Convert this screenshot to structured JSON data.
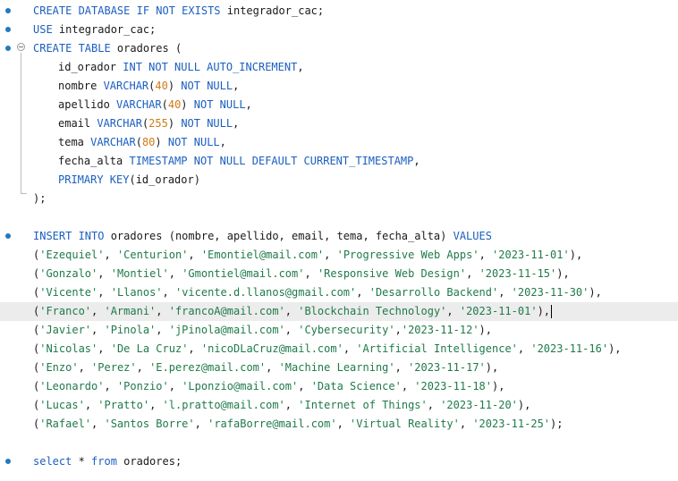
{
  "editor": {
    "colors": {
      "keyword": "#1b5fbf",
      "number": "#d27a16",
      "string": "#1f7a4a",
      "text": "#1a1a1a",
      "gutter_marker": "#1f7bc0",
      "current_line": "#ececec"
    },
    "lines": [
      {
        "marker": true,
        "tokens": [
          [
            "kw",
            "CREATE DATABASE IF NOT EXISTS "
          ],
          [
            "p",
            "integrador_cac;"
          ]
        ]
      },
      {
        "marker": true,
        "tokens": [
          [
            "kw",
            "USE "
          ],
          [
            "p",
            "integrador_cac;"
          ]
        ]
      },
      {
        "marker": true,
        "fold": true,
        "tokens": [
          [
            "kw",
            "CREATE TABLE "
          ],
          [
            "p",
            "oradores ("
          ]
        ]
      },
      {
        "indent": true,
        "tokens": [
          [
            "p",
            "id_orador "
          ],
          [
            "kw",
            "INT NOT NULL AUTO_INCREMENT"
          ],
          [
            "p",
            ","
          ]
        ]
      },
      {
        "indent": true,
        "tokens": [
          [
            "p",
            "nombre "
          ],
          [
            "kw",
            "VARCHAR"
          ],
          [
            "p",
            "("
          ],
          [
            "num",
            "40"
          ],
          [
            "p",
            ") "
          ],
          [
            "kw",
            "NOT NULL"
          ],
          [
            "p",
            ","
          ]
        ]
      },
      {
        "indent": true,
        "tokens": [
          [
            "p",
            "apellido "
          ],
          [
            "kw",
            "VARCHAR"
          ],
          [
            "p",
            "("
          ],
          [
            "num",
            "40"
          ],
          [
            "p",
            ") "
          ],
          [
            "kw",
            "NOT NULL"
          ],
          [
            "p",
            ","
          ]
        ]
      },
      {
        "indent": true,
        "tokens": [
          [
            "p",
            "email "
          ],
          [
            "kw",
            "VARCHAR"
          ],
          [
            "p",
            "("
          ],
          [
            "num",
            "255"
          ],
          [
            "p",
            ") "
          ],
          [
            "kw",
            "NOT NULL"
          ],
          [
            "p",
            ","
          ]
        ]
      },
      {
        "indent": true,
        "tokens": [
          [
            "p",
            "tema "
          ],
          [
            "kw",
            "VARCHAR"
          ],
          [
            "p",
            "("
          ],
          [
            "num",
            "80"
          ],
          [
            "p",
            ") "
          ],
          [
            "kw",
            "NOT NULL"
          ],
          [
            "p",
            ","
          ]
        ]
      },
      {
        "indent": true,
        "tokens": [
          [
            "p",
            "fecha_alta "
          ],
          [
            "kw",
            "TIMESTAMP NOT NULL DEFAULT CURRENT_TIMESTAMP"
          ],
          [
            "p",
            ","
          ]
        ]
      },
      {
        "indent": true,
        "tokens": [
          [
            "kw",
            "PRIMARY KEY"
          ],
          [
            "p",
            "(id_orador)"
          ]
        ]
      },
      {
        "tokens": [
          [
            "p",
            ");"
          ]
        ]
      },
      {
        "tokens": []
      },
      {
        "marker": true,
        "tokens": [
          [
            "kw",
            "INSERT INTO "
          ],
          [
            "p",
            "oradores (nombre, apellido, email, tema, fecha_alta) "
          ],
          [
            "kw",
            "VALUES"
          ]
        ]
      },
      {
        "tokens": [
          [
            "p",
            "("
          ],
          [
            "str",
            "'Ezequiel'"
          ],
          [
            "p",
            ", "
          ],
          [
            "str",
            "'Centurion'"
          ],
          [
            "p",
            ", "
          ],
          [
            "str",
            "'Emontiel@mail.com'"
          ],
          [
            "p",
            ", "
          ],
          [
            "str",
            "'Progressive Web Apps'"
          ],
          [
            "p",
            ", "
          ],
          [
            "str",
            "'2023-11-01'"
          ],
          [
            "p",
            "),"
          ]
        ]
      },
      {
        "tokens": [
          [
            "p",
            "("
          ],
          [
            "str",
            "'Gonzalo'"
          ],
          [
            "p",
            ", "
          ],
          [
            "str",
            "'Montiel'"
          ],
          [
            "p",
            ", "
          ],
          [
            "str",
            "'Gmontiel@mail.com'"
          ],
          [
            "p",
            ", "
          ],
          [
            "str",
            "'Responsive Web Design'"
          ],
          [
            "p",
            ", "
          ],
          [
            "str",
            "'2023-11-15'"
          ],
          [
            "p",
            "),"
          ]
        ]
      },
      {
        "tokens": [
          [
            "p",
            "("
          ],
          [
            "str",
            "'Vicente'"
          ],
          [
            "p",
            ", "
          ],
          [
            "str",
            "'Llanos'"
          ],
          [
            "p",
            ", "
          ],
          [
            "str",
            "'vicente.d.llanos@gmail.com'"
          ],
          [
            "p",
            ", "
          ],
          [
            "str",
            "'Desarrollo Backend'"
          ],
          [
            "p",
            ", "
          ],
          [
            "str",
            "'2023-11-30'"
          ],
          [
            "p",
            "),"
          ]
        ]
      },
      {
        "current": true,
        "caret": true,
        "tokens": [
          [
            "p",
            "("
          ],
          [
            "str",
            "'Franco'"
          ],
          [
            "p",
            ", "
          ],
          [
            "str",
            "'Armani'"
          ],
          [
            "p",
            ", "
          ],
          [
            "str",
            "'francoA@mail.com'"
          ],
          [
            "p",
            ", "
          ],
          [
            "str",
            "'Blockchain Technology'"
          ],
          [
            "p",
            ", "
          ],
          [
            "str",
            "'2023-11-01'"
          ],
          [
            "p",
            "),"
          ]
        ]
      },
      {
        "tokens": [
          [
            "p",
            "("
          ],
          [
            "str",
            "'Javier'"
          ],
          [
            "p",
            ", "
          ],
          [
            "str",
            "'Pinola'"
          ],
          [
            "p",
            ", "
          ],
          [
            "str",
            "'jPinola@mail.com'"
          ],
          [
            "p",
            ", "
          ],
          [
            "str",
            "'Cybersecurity'"
          ],
          [
            "p",
            ","
          ],
          [
            "str",
            "'2023-11-12'"
          ],
          [
            "p",
            "),"
          ]
        ]
      },
      {
        "tokens": [
          [
            "p",
            "("
          ],
          [
            "str",
            "'Nicolas'"
          ],
          [
            "p",
            ", "
          ],
          [
            "str",
            "'De La Cruz'"
          ],
          [
            "p",
            ", "
          ],
          [
            "str",
            "'nicoDLaCruz@mail.com'"
          ],
          [
            "p",
            ", "
          ],
          [
            "str",
            "'Artificial Intelligence'"
          ],
          [
            "p",
            ", "
          ],
          [
            "str",
            "'2023-11-16'"
          ],
          [
            "p",
            "),"
          ]
        ]
      },
      {
        "tokens": [
          [
            "p",
            "("
          ],
          [
            "str",
            "'Enzo'"
          ],
          [
            "p",
            ", "
          ],
          [
            "str",
            "'Perez'"
          ],
          [
            "p",
            ", "
          ],
          [
            "str",
            "'E.perez@mail.com'"
          ],
          [
            "p",
            ", "
          ],
          [
            "str",
            "'Machine Learning'"
          ],
          [
            "p",
            ", "
          ],
          [
            "str",
            "'2023-11-17'"
          ],
          [
            "p",
            "),"
          ]
        ]
      },
      {
        "tokens": [
          [
            "p",
            "("
          ],
          [
            "str",
            "'Leonardo'"
          ],
          [
            "p",
            ", "
          ],
          [
            "str",
            "'Ponzio'"
          ],
          [
            "p",
            ", "
          ],
          [
            "str",
            "'Lponzio@mail.com'"
          ],
          [
            "p",
            ", "
          ],
          [
            "str",
            "'Data Science'"
          ],
          [
            "p",
            ", "
          ],
          [
            "str",
            "'2023-11-18'"
          ],
          [
            "p",
            "),"
          ]
        ]
      },
      {
        "tokens": [
          [
            "p",
            "("
          ],
          [
            "str",
            "'Lucas'"
          ],
          [
            "p",
            ", "
          ],
          [
            "str",
            "'Pratto'"
          ],
          [
            "p",
            ", "
          ],
          [
            "str",
            "'l.pratto@mail.com'"
          ],
          [
            "p",
            ", "
          ],
          [
            "str",
            "'Internet of Things'"
          ],
          [
            "p",
            ", "
          ],
          [
            "str",
            "'2023-11-20'"
          ],
          [
            "p",
            "),"
          ]
        ]
      },
      {
        "tokens": [
          [
            "p",
            "("
          ],
          [
            "str",
            "'Rafael'"
          ],
          [
            "p",
            ", "
          ],
          [
            "str",
            "'Santos Borre'"
          ],
          [
            "p",
            ", "
          ],
          [
            "str",
            "'rafaBorre@mail.com'"
          ],
          [
            "p",
            ", "
          ],
          [
            "str",
            "'Virtual Reality'"
          ],
          [
            "p",
            ", "
          ],
          [
            "str",
            "'2023-11-25'"
          ],
          [
            "p",
            ");"
          ]
        ]
      },
      {
        "tokens": []
      },
      {
        "marker": true,
        "tokens": [
          [
            "kw",
            "select "
          ],
          [
            "p",
            "* "
          ],
          [
            "kw",
            "from "
          ],
          [
            "p",
            "oradores;"
          ]
        ]
      }
    ]
  }
}
